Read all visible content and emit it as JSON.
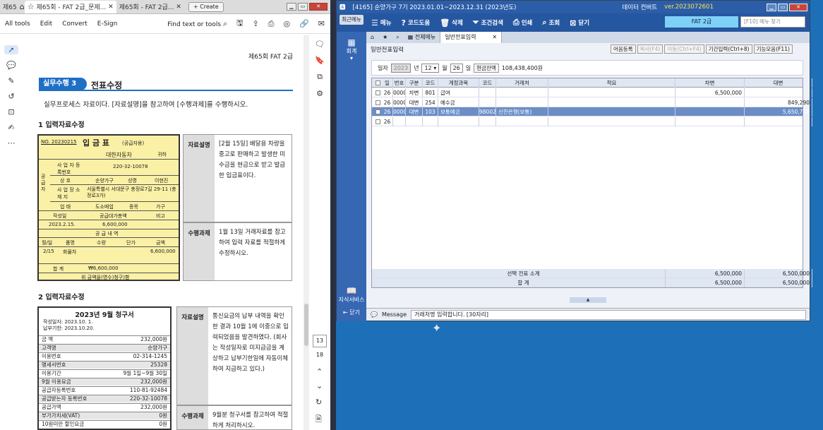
{
  "pdf": {
    "tabs": [
      {
        "label": "제65"
      },
      {
        "label": "제65회 - FAT 2급_문제..."
      },
      {
        "label": "제65회 - FAT 2급..."
      }
    ],
    "create_label": "Create",
    "toolbar": {
      "all_tools": "All tools",
      "edit": "Edit",
      "convert": "Convert",
      "esign": "E-Sign",
      "find": "Find text or tools"
    },
    "page_number": "13",
    "page_total": "18",
    "page": {
      "header": "제65회 FAT 2급",
      "section_badge": "실무수행 3",
      "section_title": "전표수정",
      "intro": "실무프로세스 자료이다. [자료설명]을 참고하여 [수행과제]를 수행하시오.",
      "sub1": "1  입력자료수정",
      "sub2": "2  입력자료수정",
      "receipt": {
        "no": "NO. 20230215",
        "title": "입 금 표",
        "supplier_tag": "(공급자용)",
        "recipient": "대한자동차",
        "honorific": "귀하",
        "reg_label": "사 업 자 등록번호",
        "reg_no": "220-32-10078",
        "name_label": "상 호",
        "name": "순양가구",
        "rep_label": "성명",
        "rep": "이현진",
        "addr_label": "사 업 장 소 재 지",
        "addr": "서울특별시 서대문구 충정로7길 29-11 (충정로3가)",
        "type_label": "업 태",
        "type": "도소매업",
        "item_label": "종목",
        "item": "가구",
        "side_label": "공급자",
        "col_date": "작성일",
        "col_amount": "공급대가총액",
        "col_note": "비고",
        "date": "2023.2.15.",
        "amount": "6,600,000",
        "detail_header": "공 급 내 역",
        "detail_cols": [
          "월/일",
          "품명",
          "수량",
          "단가",
          "금액"
        ],
        "detail_row": [
          "2/15",
          "화물차",
          "",
          "",
          "6,600,000"
        ],
        "total_label": "합 계",
        "total": "₩6,600,000",
        "footer": "위 금액을(영수)청구)함"
      },
      "box1_label": "자료설명",
      "box1_text": "[2월 15일] 배달용 차량을 중고로 판매하고 발생한 미수금을 현금으로 받고 발급한 입금표이다.",
      "box2_label": "수행과제",
      "box2_text": "1월 13일 거래자료를 참고하여 입력 자료를 적절하게 수정하시오.",
      "box3_label": "자료설명",
      "box3_text": "통신요금의 납부 내역을 확인한 결과 10월 1에 이중으로 입력되었음을 발견하였다. (회사는 작성일자로 미지급금을 계상하고 납부기한일에 자동이체하여 지급하고 있다.)",
      "box4_label": "수행과제",
      "box4_text": "9월분 청구서를 참고하여 적절하게 처리하시오.",
      "invoice": {
        "title": "2023년 9월 청구서",
        "meta1": "작성일자: 2023.10. 1.",
        "meta2": "납부기한: 2023.10.20.",
        "rows": [
          [
            "금 액",
            "232,000원"
          ],
          [
            "고객명",
            "순양가구"
          ],
          [
            "이용번호",
            "02-314-1245"
          ],
          [
            "명세서번호",
            "25328"
          ],
          [
            "이용기간",
            "9월 1일~9월 30일"
          ],
          [
            "9월 이용요금",
            "232,000원"
          ],
          [
            "공급자등록번호",
            "110-81-92484"
          ],
          [
            "공급받는자 등록번호",
            "220-32-10078"
          ],
          [
            "공급가액",
            "232,000원"
          ],
          [
            "부가가치세(VAT)",
            "0원"
          ],
          [
            "10원미만 할인요금",
            "0원"
          ]
        ]
      }
    }
  },
  "app": {
    "title": "[4165] 순양가구  7기 2023.01.01~2023.12.31 (2023년도)",
    "title_right": "데이터 컨버트",
    "version": "ver.2023072601",
    "recent_label": "최근메뉴",
    "toolbar": [
      "메뉴",
      "코드도움",
      "삭제",
      "조건검색",
      "인쇄",
      "조회",
      "닫기"
    ],
    "company": "FAT 2급",
    "search_placeholder": "[F10] 메뉴 찾기",
    "side": {
      "accounting": "회계",
      "knowledge": "지식서비스",
      "close": "닫기"
    },
    "tabs": [
      "전체메뉴",
      "일반전표입력"
    ],
    "form_title": "일반전표입력",
    "top_buttons": [
      {
        "label": "어음등록",
        "disabled": false
      },
      {
        "label": "복사(F4)",
        "disabled": true
      },
      {
        "label": "이동(Ctrl+F4)",
        "disabled": true
      },
      {
        "label": "기간입력(Ctrl+8)",
        "disabled": false
      },
      {
        "label": "기능모음(F11)",
        "disabled": false
      }
    ],
    "date": {
      "label": "일자",
      "year": "2023",
      "year_unit": "년",
      "month": "12",
      "month_unit": "월",
      "day": "26",
      "day_unit": "일",
      "cash_label": "현금잔액",
      "cash": "108,438,400원"
    },
    "columns": [
      "일",
      "번호",
      "구분",
      "코드",
      "계정과목",
      "코드",
      "거래처",
      "적요",
      "차변",
      "대변"
    ],
    "rows": [
      [
        "26",
        "00001",
        "차변",
        "801",
        "급여",
        "",
        "",
        "",
        "6,500,000",
        ""
      ],
      [
        "26",
        "00001",
        "대변",
        "254",
        "예수금",
        "",
        "",
        "",
        "",
        "849,290"
      ],
      [
        "26",
        "00001",
        "대변",
        "103",
        "보통예금",
        "98002",
        "신한은행(보통)",
        "",
        "",
        "5,650,710"
      ],
      [
        "26",
        "",
        "",
        "",
        "",
        "",
        "",
        "",
        "",
        ""
      ]
    ],
    "summary": [
      {
        "label": "선택 전표 소계",
        "debit": "6,500,000",
        "credit": "6,500,000"
      },
      {
        "label": "합          계",
        "debit": "6,500,000",
        "credit": "6,500,000"
      }
    ],
    "message_label": "Message",
    "message": "거래처명 입력합니다. [30자리]"
  }
}
